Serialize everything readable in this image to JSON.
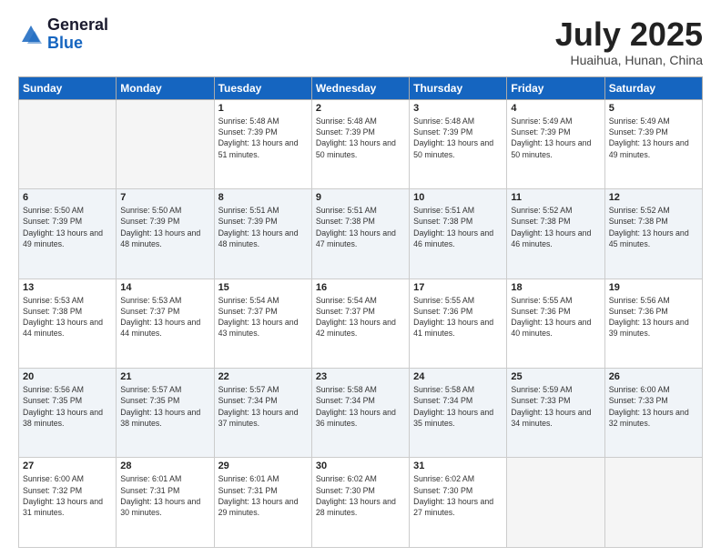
{
  "header": {
    "logo_general": "General",
    "logo_blue": "Blue",
    "title": "July 2025",
    "location": "Huaihua, Hunan, China"
  },
  "days_of_week": [
    "Sunday",
    "Monday",
    "Tuesday",
    "Wednesday",
    "Thursday",
    "Friday",
    "Saturday"
  ],
  "weeks": [
    [
      {
        "day": "",
        "info": ""
      },
      {
        "day": "",
        "info": ""
      },
      {
        "day": "1",
        "info": "Sunrise: 5:48 AM\nSunset: 7:39 PM\nDaylight: 13 hours and 51 minutes."
      },
      {
        "day": "2",
        "info": "Sunrise: 5:48 AM\nSunset: 7:39 PM\nDaylight: 13 hours and 50 minutes."
      },
      {
        "day": "3",
        "info": "Sunrise: 5:48 AM\nSunset: 7:39 PM\nDaylight: 13 hours and 50 minutes."
      },
      {
        "day": "4",
        "info": "Sunrise: 5:49 AM\nSunset: 7:39 PM\nDaylight: 13 hours and 50 minutes."
      },
      {
        "day": "5",
        "info": "Sunrise: 5:49 AM\nSunset: 7:39 PM\nDaylight: 13 hours and 49 minutes."
      }
    ],
    [
      {
        "day": "6",
        "info": "Sunrise: 5:50 AM\nSunset: 7:39 PM\nDaylight: 13 hours and 49 minutes."
      },
      {
        "day": "7",
        "info": "Sunrise: 5:50 AM\nSunset: 7:39 PM\nDaylight: 13 hours and 48 minutes."
      },
      {
        "day": "8",
        "info": "Sunrise: 5:51 AM\nSunset: 7:39 PM\nDaylight: 13 hours and 48 minutes."
      },
      {
        "day": "9",
        "info": "Sunrise: 5:51 AM\nSunset: 7:38 PM\nDaylight: 13 hours and 47 minutes."
      },
      {
        "day": "10",
        "info": "Sunrise: 5:51 AM\nSunset: 7:38 PM\nDaylight: 13 hours and 46 minutes."
      },
      {
        "day": "11",
        "info": "Sunrise: 5:52 AM\nSunset: 7:38 PM\nDaylight: 13 hours and 46 minutes."
      },
      {
        "day": "12",
        "info": "Sunrise: 5:52 AM\nSunset: 7:38 PM\nDaylight: 13 hours and 45 minutes."
      }
    ],
    [
      {
        "day": "13",
        "info": "Sunrise: 5:53 AM\nSunset: 7:38 PM\nDaylight: 13 hours and 44 minutes."
      },
      {
        "day": "14",
        "info": "Sunrise: 5:53 AM\nSunset: 7:37 PM\nDaylight: 13 hours and 44 minutes."
      },
      {
        "day": "15",
        "info": "Sunrise: 5:54 AM\nSunset: 7:37 PM\nDaylight: 13 hours and 43 minutes."
      },
      {
        "day": "16",
        "info": "Sunrise: 5:54 AM\nSunset: 7:37 PM\nDaylight: 13 hours and 42 minutes."
      },
      {
        "day": "17",
        "info": "Sunrise: 5:55 AM\nSunset: 7:36 PM\nDaylight: 13 hours and 41 minutes."
      },
      {
        "day": "18",
        "info": "Sunrise: 5:55 AM\nSunset: 7:36 PM\nDaylight: 13 hours and 40 minutes."
      },
      {
        "day": "19",
        "info": "Sunrise: 5:56 AM\nSunset: 7:36 PM\nDaylight: 13 hours and 39 minutes."
      }
    ],
    [
      {
        "day": "20",
        "info": "Sunrise: 5:56 AM\nSunset: 7:35 PM\nDaylight: 13 hours and 38 minutes."
      },
      {
        "day": "21",
        "info": "Sunrise: 5:57 AM\nSunset: 7:35 PM\nDaylight: 13 hours and 38 minutes."
      },
      {
        "day": "22",
        "info": "Sunrise: 5:57 AM\nSunset: 7:34 PM\nDaylight: 13 hours and 37 minutes."
      },
      {
        "day": "23",
        "info": "Sunrise: 5:58 AM\nSunset: 7:34 PM\nDaylight: 13 hours and 36 minutes."
      },
      {
        "day": "24",
        "info": "Sunrise: 5:58 AM\nSunset: 7:34 PM\nDaylight: 13 hours and 35 minutes."
      },
      {
        "day": "25",
        "info": "Sunrise: 5:59 AM\nSunset: 7:33 PM\nDaylight: 13 hours and 34 minutes."
      },
      {
        "day": "26",
        "info": "Sunrise: 6:00 AM\nSunset: 7:33 PM\nDaylight: 13 hours and 32 minutes."
      }
    ],
    [
      {
        "day": "27",
        "info": "Sunrise: 6:00 AM\nSunset: 7:32 PM\nDaylight: 13 hours and 31 minutes."
      },
      {
        "day": "28",
        "info": "Sunrise: 6:01 AM\nSunset: 7:31 PM\nDaylight: 13 hours and 30 minutes."
      },
      {
        "day": "29",
        "info": "Sunrise: 6:01 AM\nSunset: 7:31 PM\nDaylight: 13 hours and 29 minutes."
      },
      {
        "day": "30",
        "info": "Sunrise: 6:02 AM\nSunset: 7:30 PM\nDaylight: 13 hours and 28 minutes."
      },
      {
        "day": "31",
        "info": "Sunrise: 6:02 AM\nSunset: 7:30 PM\nDaylight: 13 hours and 27 minutes."
      },
      {
        "day": "",
        "info": ""
      },
      {
        "day": "",
        "info": ""
      }
    ]
  ]
}
